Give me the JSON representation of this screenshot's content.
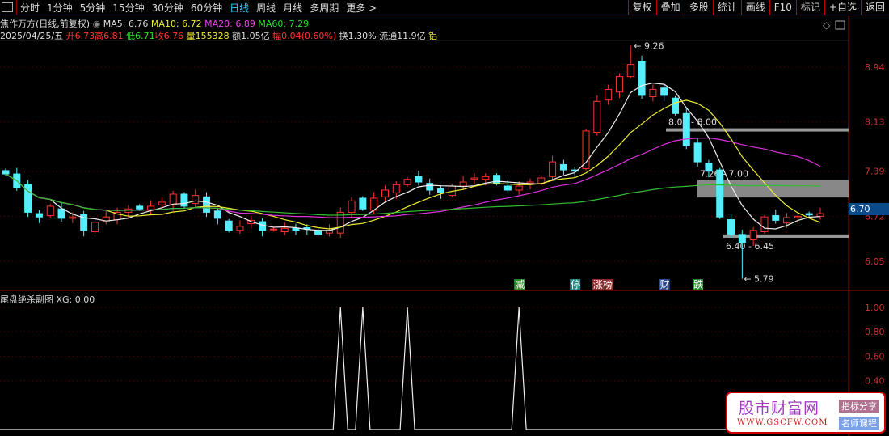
{
  "topbar": {
    "periods": [
      "分时",
      "1分钟",
      "5分钟",
      "15分钟",
      "30分钟",
      "60分钟",
      "日线",
      "周线",
      "月线",
      "多周期",
      "更多 >"
    ],
    "active": "日线",
    "tools": [
      "复权",
      "叠加",
      "多股",
      "统计",
      "画线",
      "F10",
      "标记",
      "+自选",
      "返回"
    ]
  },
  "info": {
    "title": "焦作万方(日线,前复权)",
    "ma5": "MA5: 6.76",
    "ma10": "MA10: 6.72",
    "ma20": "MA20: 6.89",
    "ma60": "MA60: 7.29",
    "date": "2025/04/25/五",
    "open": "开6.73",
    "high": "高6.81",
    "low": "低6.71",
    "close": "收6.76",
    "vol": "量155328",
    "amount": "额1.05亿",
    "change": "幅0.04(0.60%)",
    "turnover": "换1.30%",
    "float": "流通11.9亿",
    "tag": "铝"
  },
  "chart_data": {
    "type": "candlestick",
    "closes": [
      7.35,
      7.15,
      6.78,
      6.71,
      6.87,
      6.69,
      6.71,
      6.51,
      6.63,
      6.71,
      6.78,
      6.83,
      6.83,
      6.87,
      6.93,
      7.05,
      6.87,
      7.03,
      6.78,
      6.69,
      6.51,
      6.57,
      6.66,
      6.51,
      6.53,
      6.54,
      6.51,
      6.53,
      6.45,
      6.51,
      6.78,
      6.95,
      6.83,
      6.99,
      7.11,
      7.19,
      7.27,
      7.23,
      7.11,
      7.07,
      7.17,
      7.23,
      7.29,
      7.31,
      7.21,
      7.11,
      7.17,
      7.23,
      7.29,
      7.53,
      7.41,
      7.39,
      7.99,
      8.43,
      8.61,
      8.8,
      8.98,
      8.52,
      8.61,
      8.52,
      8.25,
      7.77,
      7.53,
      7.39,
      6.71,
      6.45,
      6.33,
      6.51,
      6.71,
      6.66,
      6.7,
      6.72,
      6.74,
      6.76
    ],
    "price_ticks": [
      "8.94",
      "8.13",
      "7.39",
      "6.72",
      "6.05"
    ],
    "price_ticks_values": [
      8.94,
      8.13,
      7.39,
      6.72,
      6.05
    ],
    "current_price": "6.70",
    "max_label": "9.26",
    "min_label": "5.79",
    "zones": [
      {
        "label": "8.03 - 8.00",
        "lo": 8.0,
        "hi": 8.03
      },
      {
        "label": "7.26 - 7.00",
        "lo": 7.0,
        "hi": 7.26
      },
      {
        "label": "6.40 - 6.45",
        "lo": 6.4,
        "hi": 6.45
      }
    ],
    "events": [
      {
        "label": "减",
        "color": "#2a8a2a",
        "i": 46
      },
      {
        "label": "停",
        "color": "#2a8a8a",
        "i": 51
      },
      {
        "label": "涨榜",
        "color": "#8a2a2a",
        "i": 53
      },
      {
        "label": "财",
        "color": "#2a4a8a",
        "i": 59
      },
      {
        "label": "跌",
        "color": "#2a8a2a",
        "i": 62
      }
    ],
    "xg": {
      "title": "尾盘绝杀副图 XG: 0.00",
      "ticks": [
        "1.00",
        "0.80",
        "0.60",
        "0.40"
      ],
      "signals": [
        30,
        32,
        36,
        46
      ]
    }
  },
  "logo": {
    "name": "股市财富网",
    "url": "WWW.GSCFW.COM",
    "tag1": "指标分享",
    "tag2": "名师课程"
  }
}
